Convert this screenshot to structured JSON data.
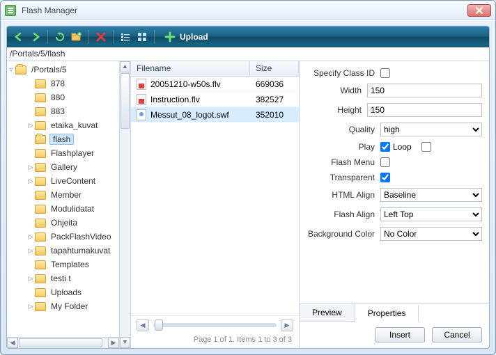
{
  "window": {
    "title": "Flash Manager"
  },
  "toolbar": {
    "upload_label": "Upload"
  },
  "path": "/Portals/5/flash",
  "tree": {
    "root": "/Portals/5",
    "items": [
      {
        "label": "878",
        "depth": 1,
        "expander": ""
      },
      {
        "label": "880",
        "depth": 1,
        "expander": ""
      },
      {
        "label": "883",
        "depth": 1,
        "expander": ""
      },
      {
        "label": "etaika_kuvat",
        "depth": 1,
        "expander": "▷"
      },
      {
        "label": "flash",
        "depth": 1,
        "expander": "",
        "selected": true,
        "open": true
      },
      {
        "label": "Flashplayer",
        "depth": 1,
        "expander": ""
      },
      {
        "label": "Gallery",
        "depth": 1,
        "expander": "▷"
      },
      {
        "label": "LiveContent",
        "depth": 1,
        "expander": "▷"
      },
      {
        "label": "Member",
        "depth": 1,
        "expander": ""
      },
      {
        "label": "Modulidatat",
        "depth": 1,
        "expander": ""
      },
      {
        "label": "Ohjeita",
        "depth": 1,
        "expander": ""
      },
      {
        "label": "PackFlashVideo",
        "depth": 1,
        "expander": "▷"
      },
      {
        "label": "tapahtumakuvat",
        "depth": 1,
        "expander": "▷"
      },
      {
        "label": "Templates",
        "depth": 1,
        "expander": ""
      },
      {
        "label": "testi t",
        "depth": 1,
        "expander": "▷"
      },
      {
        "label": "Uploads",
        "depth": 1,
        "expander": ""
      },
      {
        "label": "My Folder",
        "depth": 1,
        "expander": "▷"
      }
    ]
  },
  "filelist": {
    "headers": {
      "name": "Filename",
      "size": "Size"
    },
    "rows": [
      {
        "name": "20051210-w50s.flv",
        "size": "669036",
        "icon": "flv"
      },
      {
        "name": "Instruction.flv",
        "size": "382527",
        "icon": "flv"
      },
      {
        "name": "Messut_08_logot.swf",
        "size": "352010",
        "icon": "swf",
        "selected": true
      }
    ],
    "status": "Page 1 of 1. Items 1 to 3 of 3"
  },
  "props": {
    "labels": {
      "classid": "Specify Class ID",
      "width": "Width",
      "height": "Height",
      "quality": "Quality",
      "play": "Play",
      "loop": "Loop",
      "flashmenu": "Flash Menu",
      "transparent": "Transparent",
      "htmlalign": "HTML Align",
      "flashalign": "Flash Align",
      "bgcolor": "Background Color"
    },
    "values": {
      "classid": false,
      "width": "150",
      "height": "150",
      "quality": "high",
      "play": true,
      "loop": false,
      "flashmenu": false,
      "transparent": true,
      "htmlalign": "Baseline",
      "flashalign": "Left Top",
      "bgcolor": "No Color"
    }
  },
  "tabs": {
    "preview": "Preview",
    "properties": "Properties"
  },
  "buttons": {
    "insert": "Insert",
    "cancel": "Cancel"
  }
}
